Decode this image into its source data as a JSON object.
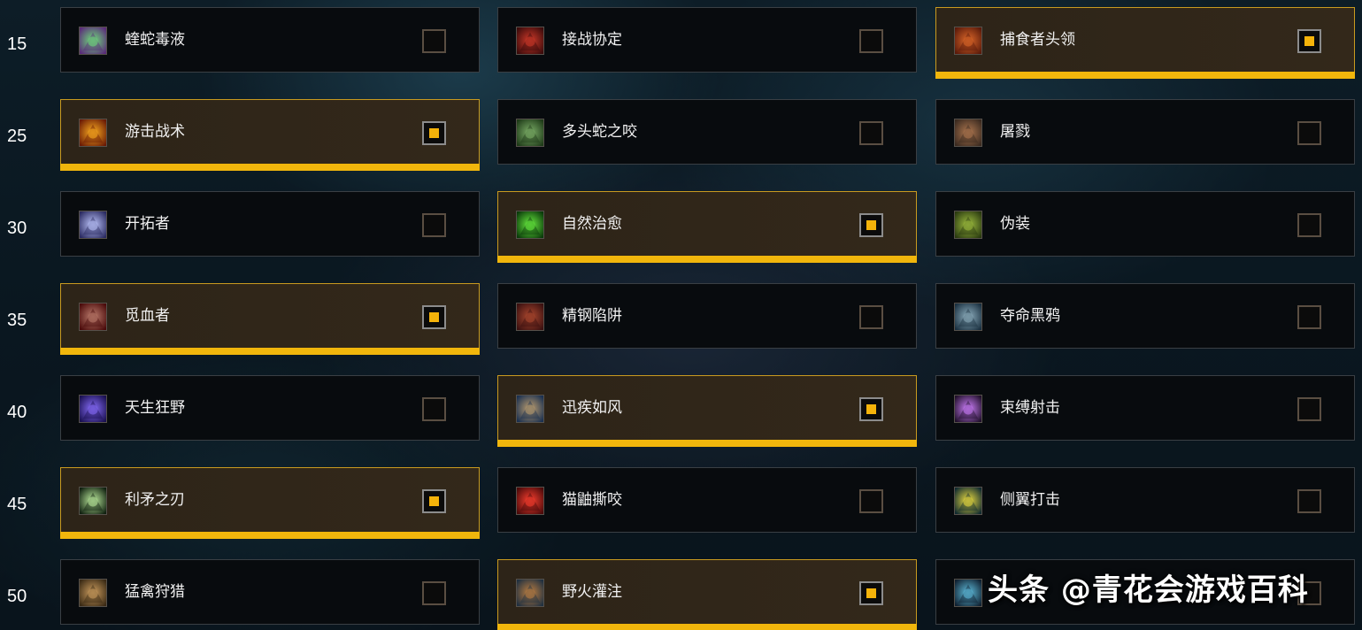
{
  "rows": [
    {
      "level": "15",
      "talents": [
        {
          "name": "蝰蛇毒液",
          "selected": false,
          "icon": "viper-venom-icon",
          "colors": [
            "#5a2a7a",
            "#6fe07a"
          ]
        },
        {
          "name": "接战协定",
          "selected": false,
          "icon": "engagement-icon",
          "colors": [
            "#3a0b0b",
            "#d23a2a"
          ]
        },
        {
          "name": "捕食者头领",
          "selected": true,
          "icon": "alpha-predator-icon",
          "colors": [
            "#5a1a0a",
            "#e0692a"
          ]
        }
      ]
    },
    {
      "level": "25",
      "talents": [
        {
          "name": "游击战术",
          "selected": true,
          "icon": "guerrilla-tactics-icon",
          "colors": [
            "#6a1a05",
            "#ffb020"
          ]
        },
        {
          "name": "多头蛇之咬",
          "selected": false,
          "icon": "hydras-bite-icon",
          "colors": [
            "#1e3a18",
            "#7fb26a"
          ]
        },
        {
          "name": "屠戮",
          "selected": false,
          "icon": "butchery-icon",
          "colors": [
            "#3a2a20",
            "#b07850"
          ]
        }
      ]
    },
    {
      "level": "30",
      "talents": [
        {
          "name": "开拓者",
          "selected": false,
          "icon": "trailblazer-icon",
          "colors": [
            "#2a2a60",
            "#c0c8ff"
          ]
        },
        {
          "name": "自然治愈",
          "selected": true,
          "icon": "natural-mending-icon",
          "colors": [
            "#0a3a0a",
            "#6af040"
          ]
        },
        {
          "name": "伪装",
          "selected": false,
          "icon": "camouflage-icon",
          "colors": [
            "#2a3a10",
            "#a0c040"
          ]
        }
      ]
    },
    {
      "level": "35",
      "talents": [
        {
          "name": "觅血者",
          "selected": true,
          "icon": "bloodseeker-icon",
          "colors": [
            "#4a0a0a",
            "#c08070"
          ]
        },
        {
          "name": "精钢陷阱",
          "selected": false,
          "icon": "steel-trap-icon",
          "colors": [
            "#3a1010",
            "#b04a30"
          ]
        },
        {
          "name": "夺命黑鸦",
          "selected": false,
          "icon": "a-murder-of-crows-icon",
          "colors": [
            "#1a3040",
            "#8fb0c0"
          ]
        }
      ]
    },
    {
      "level": "40",
      "talents": [
        {
          "name": "天生狂野",
          "selected": false,
          "icon": "born-to-be-wild-icon",
          "colors": [
            "#1a1050",
            "#8a70ff"
          ]
        },
        {
          "name": "迅疾如风",
          "selected": true,
          "icon": "posthaste-icon",
          "colors": [
            "#1a3050",
            "#c0a070"
          ]
        },
        {
          "name": "束缚射击",
          "selected": false,
          "icon": "binding-shot-icon",
          "colors": [
            "#20102a",
            "#d080ff"
          ]
        }
      ]
    },
    {
      "level": "45",
      "talents": [
        {
          "name": "利矛之刃",
          "selected": true,
          "icon": "tip-of-the-spear-icon",
          "colors": [
            "#102010",
            "#c0f0a0"
          ]
        },
        {
          "name": "猫鼬撕咬",
          "selected": false,
          "icon": "mongoose-bite-icon",
          "colors": [
            "#4a0a0a",
            "#ff4030"
          ]
        },
        {
          "name": "侧翼打击",
          "selected": false,
          "icon": "flanking-strike-icon",
          "colors": [
            "#102a30",
            "#f0e040"
          ]
        }
      ]
    },
    {
      "level": "50",
      "talents": [
        {
          "name": "猛禽狩猎",
          "selected": false,
          "icon": "birds-of-prey-icon",
          "colors": [
            "#3a2a15",
            "#d0a060"
          ]
        },
        {
          "name": "野火灌注",
          "selected": true,
          "icon": "wildfire-infusion-icon",
          "colors": [
            "#203040",
            "#c08040"
          ]
        },
        {
          "name": "",
          "selected": false,
          "icon": "chakrams-icon",
          "colors": [
            "#102030",
            "#60c0e0"
          ]
        }
      ]
    }
  ],
  "watermark": "头条 @青花会游戏百科",
  "accent_color": "#f1b60c"
}
